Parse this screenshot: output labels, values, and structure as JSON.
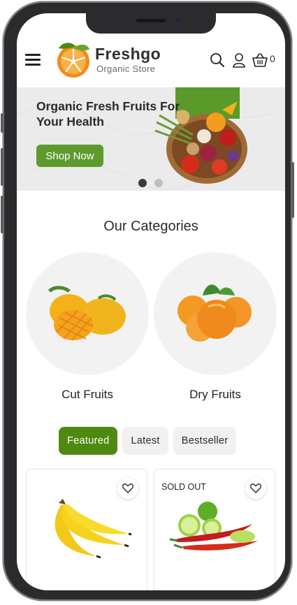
{
  "brand": {
    "name": "Freshgo",
    "tagline": "Organic Store"
  },
  "header": {
    "cart_count": "0",
    "icons": [
      "menu-icon",
      "search-icon",
      "user-icon",
      "cart-icon"
    ]
  },
  "hero": {
    "title": "Organic Fresh Fruits For Your Health",
    "button": "Shop Now",
    "slides": 2,
    "active_slide": 1
  },
  "categories": {
    "title": "Our Categories",
    "items": [
      {
        "label": "Cut Fruits"
      },
      {
        "label": "Dry Fruits"
      }
    ]
  },
  "tabs": [
    {
      "label": "Featured",
      "active": true
    },
    {
      "label": "Latest",
      "active": false
    },
    {
      "label": "Bestseller",
      "active": false
    }
  ],
  "products": [
    {
      "image": "bananas",
      "badge": ""
    },
    {
      "image": "lime-and-chili",
      "badge": "SOLD OUT"
    }
  ],
  "colors": {
    "primary_green": "#5d9b2e",
    "tab_active": "#4e8a10",
    "logo_orange": "#f07a1a"
  }
}
